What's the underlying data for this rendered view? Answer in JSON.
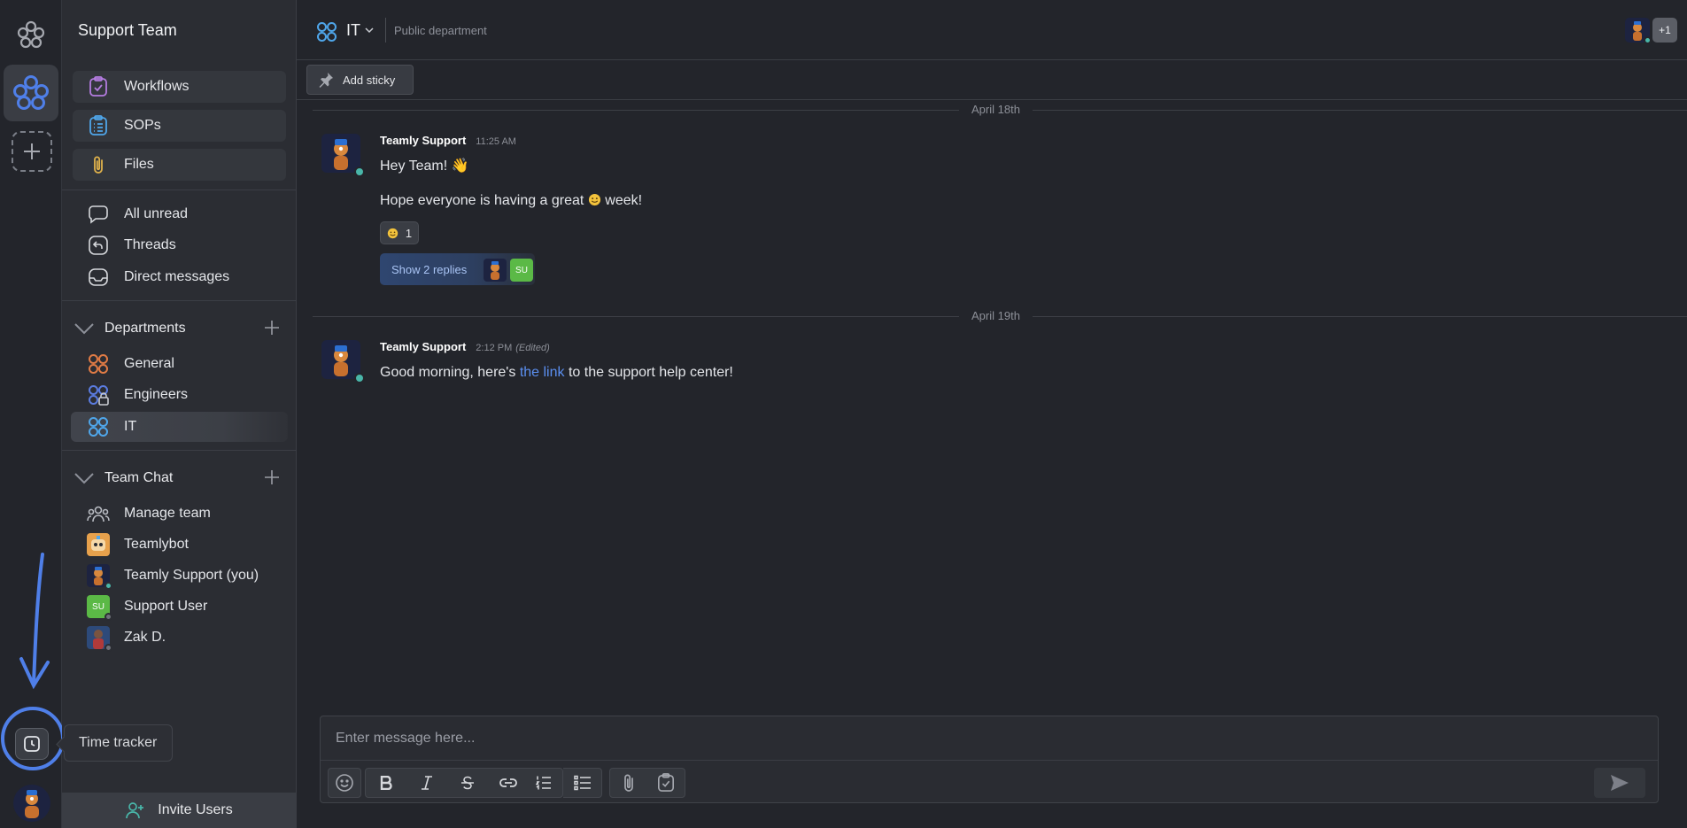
{
  "sidebar": {
    "title": "Support Team",
    "features": [
      {
        "label": "Workflows",
        "icon": "workflow-check-icon",
        "color": "#b47ce0"
      },
      {
        "label": "SOPs",
        "icon": "list-icon",
        "color": "#4fa6ea"
      },
      {
        "label": "Files",
        "icon": "paperclip-icon",
        "color": "#e0b24b"
      }
    ],
    "nav": [
      {
        "label": "All unread",
        "icon": "chat-bubble-icon"
      },
      {
        "label": "Threads",
        "icon": "reply-icon"
      },
      {
        "label": "Direct messages",
        "icon": "inbox-icon"
      }
    ],
    "departments": {
      "title": "Departments",
      "items": [
        {
          "label": "General",
          "color": "#e07b45"
        },
        {
          "label": "Engineers",
          "color": "#5b7ce0"
        },
        {
          "label": "IT",
          "color": "#4fa6ea",
          "active": true
        }
      ]
    },
    "team_chat": {
      "title": "Team Chat",
      "items": [
        {
          "label": "Manage team"
        },
        {
          "label": "Teamlybot"
        },
        {
          "label": "Teamly Support (you)"
        },
        {
          "label": "Support User",
          "initials": "SU"
        },
        {
          "label": "Zak D."
        }
      ]
    },
    "invite_label": "Invite Users"
  },
  "rail": {
    "tooltip": "Time tracker"
  },
  "channel": {
    "name": "IT",
    "description": "Public department",
    "member_overflow": "+1",
    "add_sticky_label": "Add sticky"
  },
  "messages": {
    "date1": "April 18th",
    "m1": {
      "author": "Teamly Support",
      "time": "11:25 AM",
      "line1": "Hey Team! 👋",
      "line2_a": "Hope everyone is having a great",
      "line2_b": "week!",
      "reaction_count": "1",
      "replies_label": "Show 2 replies",
      "reply_initials": "SU"
    },
    "date2": "April 19th",
    "m2": {
      "author": "Teamly Support",
      "time": "2:12 PM",
      "edited": "(Edited)",
      "text_a": "Good morning, here's",
      "link": "the link",
      "text_b": "to the support help center!"
    }
  },
  "composer": {
    "placeholder": "Enter message here..."
  },
  "colors": {
    "accent": "#4f7fe8",
    "online": "#49b6a9",
    "su_green": "#5bb946"
  }
}
